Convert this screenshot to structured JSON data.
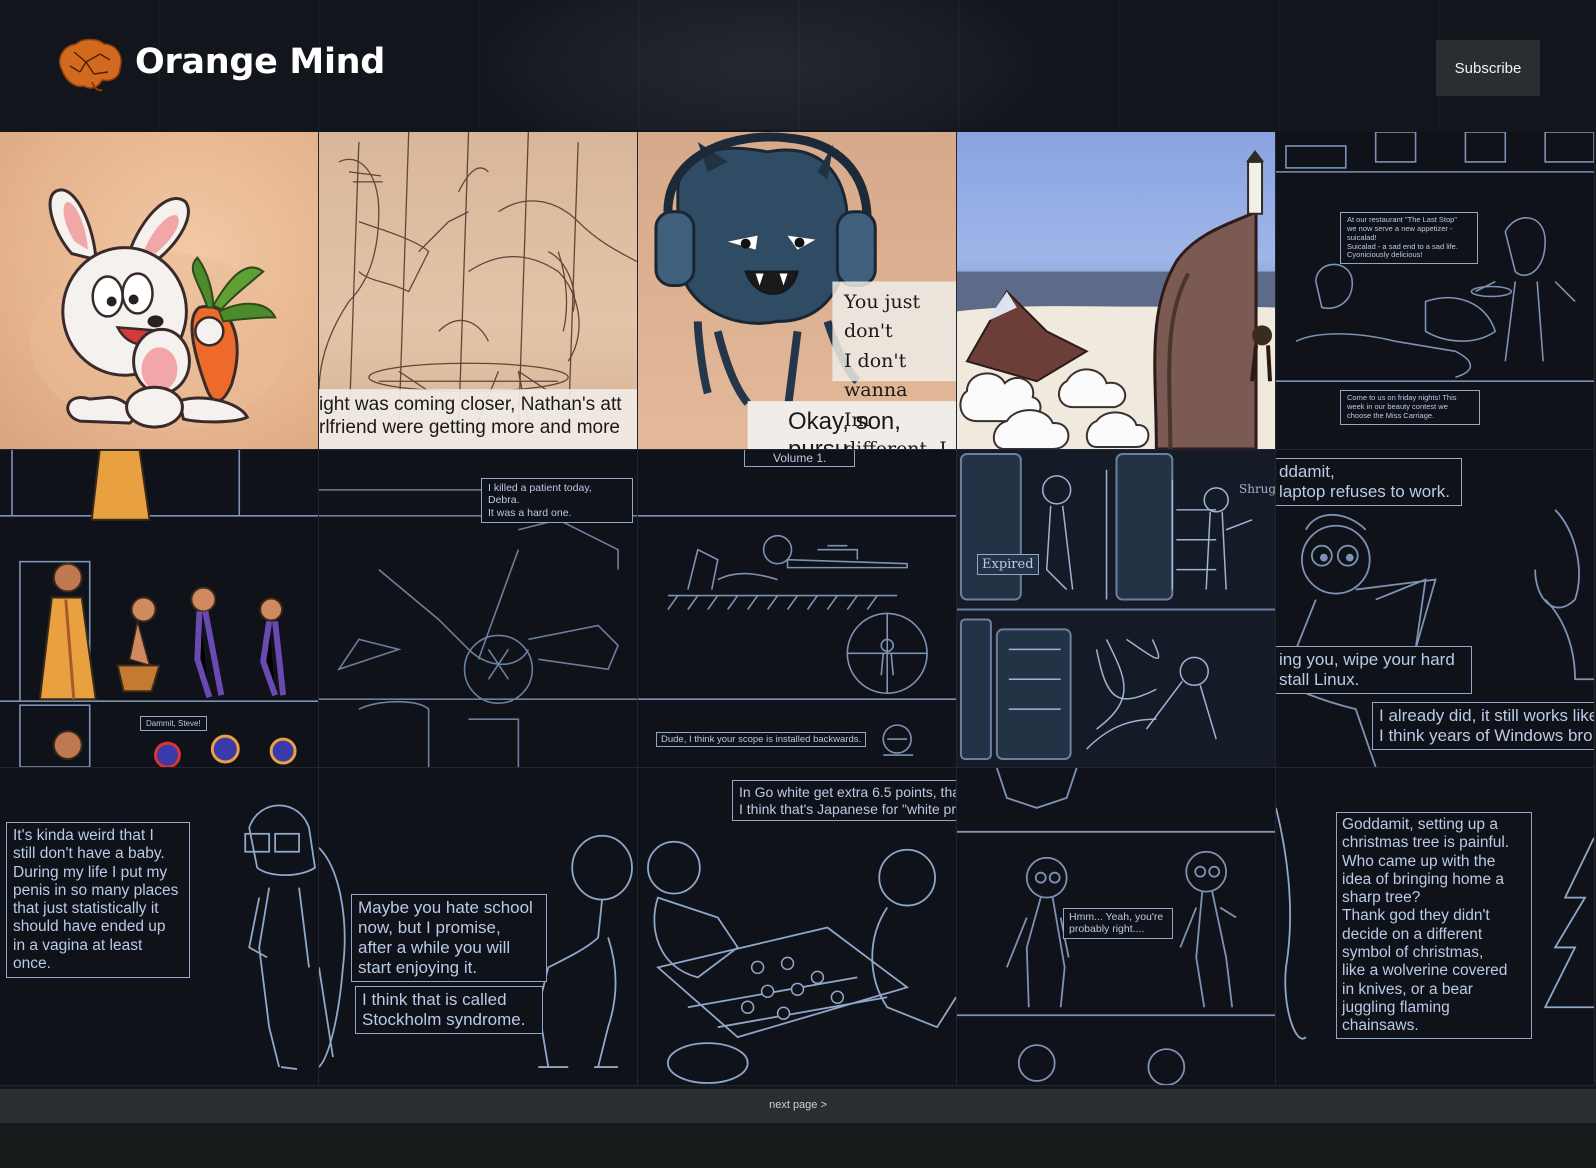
{
  "site": {
    "title": "Orange Mind",
    "logo_icon": "orange-brain-icon",
    "subscribe_label": "Subscribe"
  },
  "colors": {
    "header_bg": "#12151c",
    "brain_orange": "#d2691e",
    "sketch_line": "#8fa7c9",
    "tile_dark": "#0f1219",
    "footer_bg": "#2b2e31"
  },
  "tiles": [
    {
      "kind": "bunny-carrot"
    },
    {
      "kind": "sketch-ghost",
      "caption": "ight was coming closer, Nathan's att\nrlfriend were getting more and more"
    },
    {
      "kind": "blue-monster",
      "speech": "You just don't\nI don't wanna\nIm different, I",
      "caption": "Okay, son, pursu"
    },
    {
      "kind": "lighthouse-cliff"
    },
    {
      "kind": "restaurant",
      "bubble1": "At our restaurant \"The Last Stop\"\nwe now serve a new appetizer -\nsuicalad!\nSuicalad - a sad end to a sad life.\nCyoniciously delicious!",
      "bubble2": "Come to us on friday nights! This\nweek in our beauty contest we\nchoose the Miss Carriage."
    },
    {
      "kind": "monks",
      "bubble": "Dammit, Steve!"
    },
    {
      "kind": "patient",
      "bubble": "I killed a patient today, Debra.\nIt was a hard one."
    },
    {
      "kind": "sniper",
      "title": "Volume 1.",
      "bubble": "Dude, I think your scope is installed backwards."
    },
    {
      "kind": "fridge",
      "label1": "Expired",
      "label2": "Shrug"
    },
    {
      "kind": "laptop",
      "bubble1": "ddamit,\nlaptop refuses to work.",
      "bubble2": "ing you, wipe your hard\nstall Linux.",
      "bubble3": "I already did, it still works like\nI think years of Windows bro"
    },
    {
      "kind": "baby",
      "bubble": "It's kinda weird that I\nstill don't have a baby.\nDuring my life I put my\npenis in so many places\nthat just statistically it\nshould have ended up\nin a vagina at least\nonce."
    },
    {
      "kind": "school",
      "bubble1": "Maybe you hate school\nnow, but I promise,\nafter a while you will\nstart enjoying it.",
      "bubble2": "I think that is called\nStockholm syndrome."
    },
    {
      "kind": "go-game",
      "bubble": "In Go white get extra 6.5 points, tha\nI think that's Japanese for \"white pr"
    },
    {
      "kind": "hmm",
      "bubble": "Hmm... Yeah, you're\nprobably right...."
    },
    {
      "kind": "christmas",
      "bubble": "Goddamit, setting up a\nchristmas tree is painful.\nWho came up with the\nidea of bringing home a\nsharp tree?\nThank god they didn't\ndecide on a different\nsymbol of christmas,\nlike a wolverine covered\nin knives, or a bear\njuggling flaming\nchainsaws."
    }
  ],
  "pagination": {
    "next_label": "next page >"
  }
}
